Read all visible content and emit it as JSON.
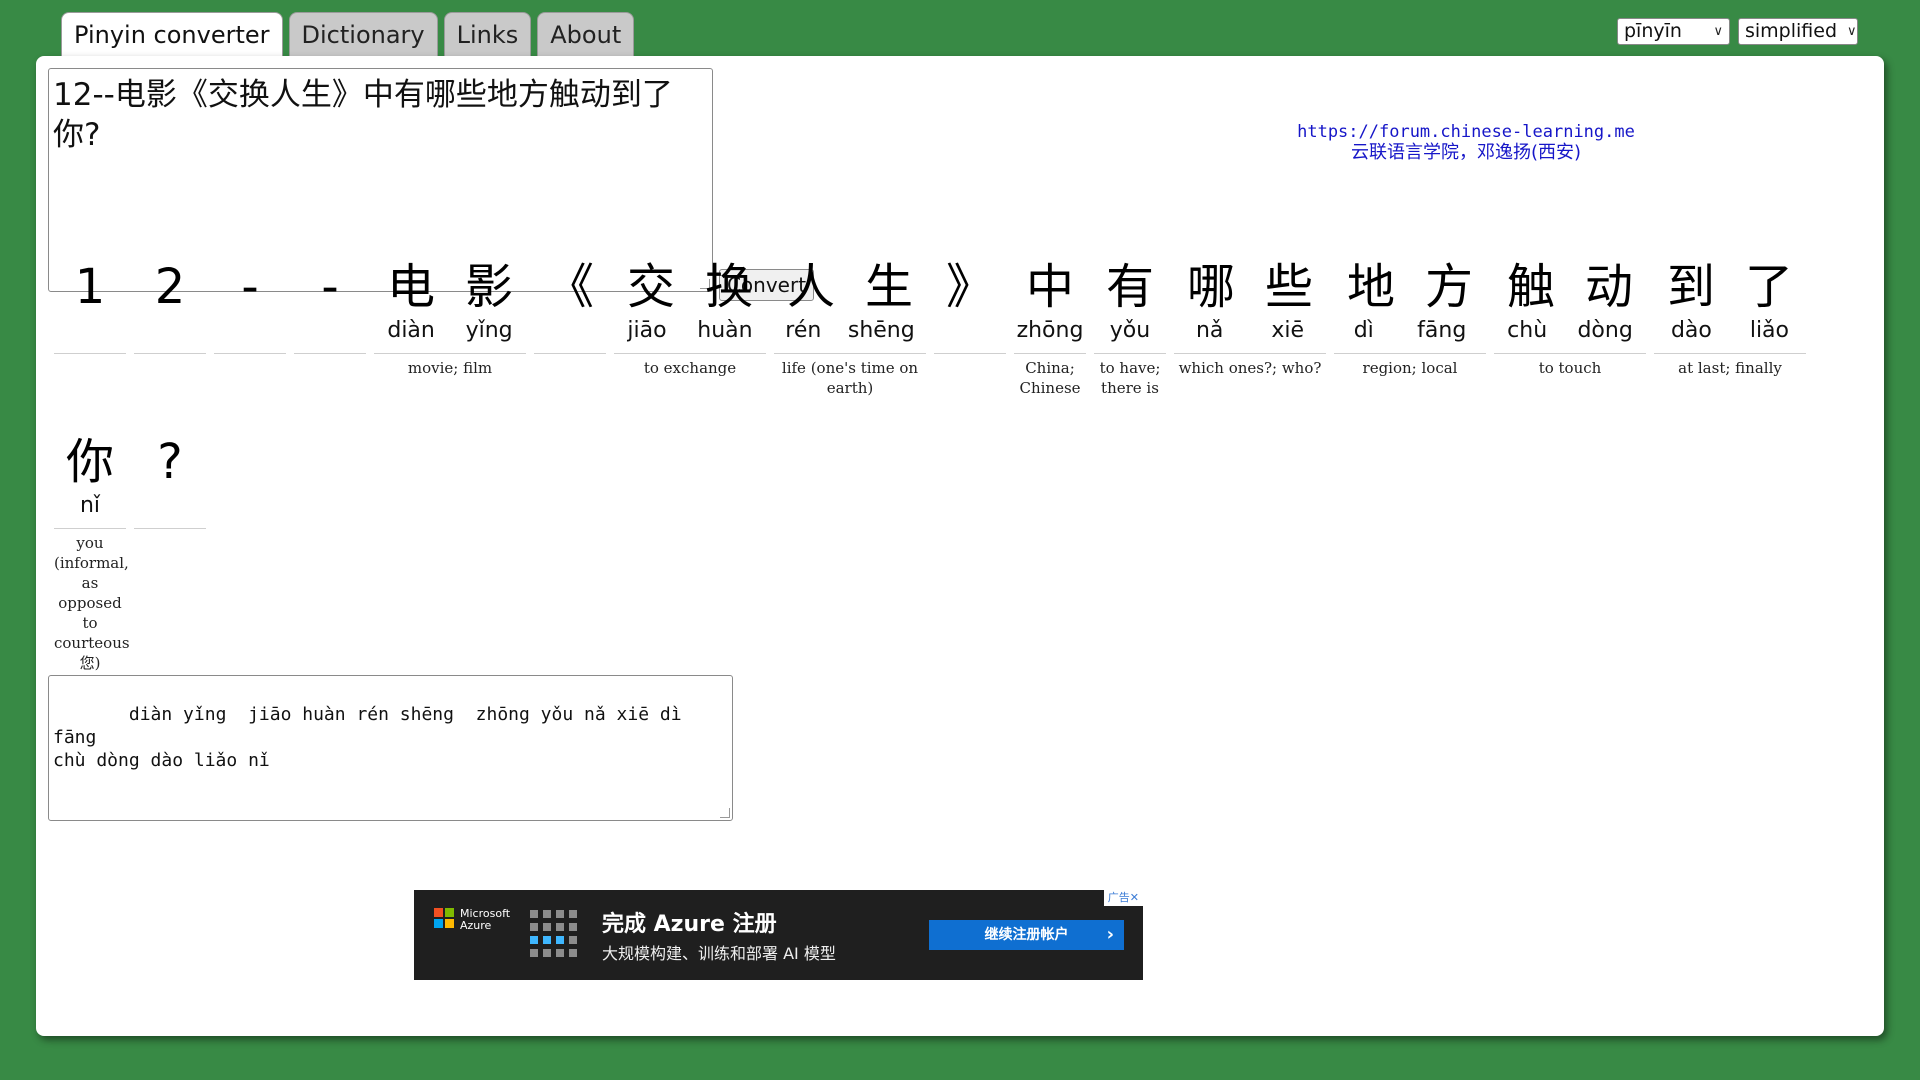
{
  "tabs": [
    "Pinyin converter",
    "Dictionary",
    "Links",
    "About"
  ],
  "selects": {
    "romanization": "pīnyīn",
    "script": "simplified"
  },
  "input_text": "12--电影《交换人生》中有哪些地方触动到了你?",
  "convert_label": "Convert",
  "forum": {
    "url": "https://forum.chinese-learning.me",
    "subtitle": "云联语言学院，邓逸扬(西安)"
  },
  "words": [
    {
      "chars": [
        "1"
      ],
      "pinyin": [
        ""
      ],
      "def": ""
    },
    {
      "chars": [
        "2"
      ],
      "pinyin": [
        ""
      ],
      "def": ""
    },
    {
      "chars": [
        "-"
      ],
      "pinyin": [
        ""
      ],
      "def": ""
    },
    {
      "chars": [
        "-"
      ],
      "pinyin": [
        ""
      ],
      "def": ""
    },
    {
      "chars": [
        "电",
        "影"
      ],
      "pinyin": [
        "diàn",
        "yǐng"
      ],
      "def": "movie; film"
    },
    {
      "chars": [
        "《"
      ],
      "pinyin": [
        ""
      ],
      "def": ""
    },
    {
      "chars": [
        "交",
        "换"
      ],
      "pinyin": [
        "jiāo",
        "huàn"
      ],
      "def": "to exchange"
    },
    {
      "chars": [
        "人",
        "生"
      ],
      "pinyin": [
        "rén",
        "shēng"
      ],
      "def": "life (one's time on earth)"
    },
    {
      "chars": [
        "》"
      ],
      "pinyin": [
        ""
      ],
      "def": ""
    },
    {
      "chars": [
        "中"
      ],
      "pinyin": [
        "zhōng"
      ],
      "def": "China; Chinese"
    },
    {
      "chars": [
        "有"
      ],
      "pinyin": [
        "yǒu"
      ],
      "def": "to have; there is"
    },
    {
      "chars": [
        "哪",
        "些"
      ],
      "pinyin": [
        "nǎ",
        "xiē"
      ],
      "def": "which ones?; who?"
    },
    {
      "chars": [
        "地",
        "方"
      ],
      "pinyin": [
        "dì",
        "fāng"
      ],
      "def": "region; local"
    },
    {
      "chars": [
        "触",
        "动"
      ],
      "pinyin": [
        "chù",
        "dòng"
      ],
      "def": "to touch"
    },
    {
      "chars": [
        "到",
        "了"
      ],
      "pinyin": [
        "dào",
        "liǎo"
      ],
      "def": "at last; finally"
    },
    {
      "chars": [
        "你"
      ],
      "pinyin": [
        "nǐ"
      ],
      "def": "you (informal, as opposed to courteous 您)"
    },
    {
      "chars": [
        "?"
      ],
      "pinyin": [
        ""
      ],
      "def": ""
    }
  ],
  "output_text": "   diàn yǐng  jiāo huàn rén shēng  zhōng yǒu nǎ xiē dì fāng\nchù dòng dào liǎo nǐ",
  "ad": {
    "brand_line1": "Microsoft",
    "brand_line2": "Azure",
    "headline": "完成 Azure 注册",
    "subline": "大规模构建、训练和部署 AI 模型",
    "cta": "继续注册帐户",
    "cta_arrow": "›",
    "adchoice": "广告✕"
  },
  "colors": {
    "background": "#388a45",
    "link": "#1616c8",
    "ad_cta": "#0f6fd1"
  }
}
